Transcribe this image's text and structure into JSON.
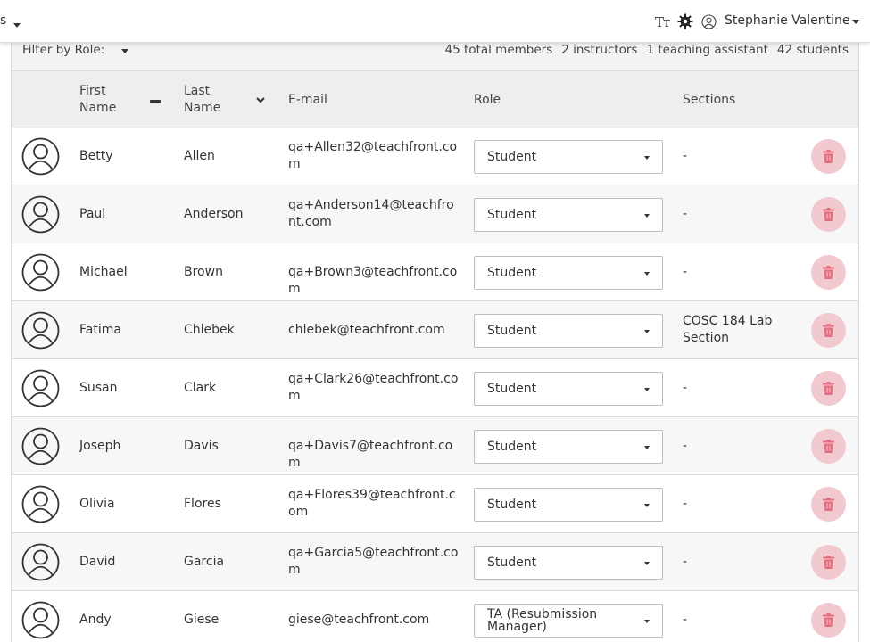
{
  "topbar": {
    "left_fragment": "s",
    "text_size_icon": "Tт",
    "user_name": "Stephanie Valentine",
    "icons": [
      "text-size-icon",
      "gear-icon",
      "user-icon",
      "chevron-down-icon"
    ]
  },
  "filter": {
    "label": "Filter by Role:",
    "stats": {
      "total": "45 total members",
      "instructors": "2 instructors",
      "tas": "1 teaching assistant",
      "students": "42 students"
    }
  },
  "table": {
    "headers": {
      "first_line1": "First",
      "first_line2": "Name",
      "last_line1": "Last",
      "last_line2": "Name",
      "email": "E-mail",
      "role": "Role",
      "sections": "Sections"
    },
    "rows": [
      {
        "first": "Betty",
        "last": "Allen",
        "email": "qa+Allen32@teachfront.com",
        "role": "Student",
        "sections": "-"
      },
      {
        "first": "Paul",
        "last": "Anderson",
        "email": "qa+Anderson14@teachfront.com",
        "role": "Student",
        "sections": "-"
      },
      {
        "first": "Michael",
        "last": "Brown",
        "email": "qa+Brown3@teachfront.com",
        "role": "Student",
        "sections": "-"
      },
      {
        "first": "Fatima",
        "last": "Chlebek",
        "email": "chlebek@teachfront.com",
        "role": "Student",
        "sections": "COSC 184 Lab Section"
      },
      {
        "first": "Susan",
        "last": "Clark",
        "email": "qa+Clark26@teachfront.com",
        "role": "Student",
        "sections": "-"
      },
      {
        "first": "Joseph",
        "last": "Davis",
        "email": "qa+Davis7@teachfront.com",
        "role": "Student",
        "sections": "-"
      },
      {
        "first": "Olivia",
        "last": "Flores",
        "email": "qa+Flores39@teachfront.com",
        "role": "Student",
        "sections": "-"
      },
      {
        "first": "David",
        "last": "Garcia",
        "email": "qa+Garcia5@teachfront.com",
        "role": "Student",
        "sections": "-"
      },
      {
        "first": "Andy",
        "last": "Giese",
        "email": "giese@teachfront.com",
        "role": "TA (Resubmission Manager)",
        "sections": "-"
      }
    ]
  },
  "colors": {
    "delete_button_bg": "#f2c9cf",
    "delete_icon": "#e06e7e",
    "header_bg": "#eeeeee",
    "alt_row_bg": "#f7f7f7"
  }
}
